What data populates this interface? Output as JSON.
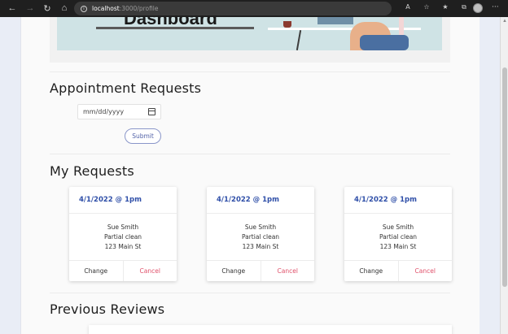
{
  "browser": {
    "url_host": "localhost",
    "url_path": ":3000/profile",
    "info_glyph": "i",
    "nav_icons": [
      "back-arrow-icon",
      "forward-arrow-icon",
      "refresh-icon",
      "home-icon"
    ],
    "toolbar_icons": [
      "read-aloud-icon",
      "favorite-icon",
      "favorites-bar-icon",
      "collections-icon",
      "profile-avatar-icon",
      "more-icon"
    ]
  },
  "hero": {
    "title": "Dashboard"
  },
  "appointment": {
    "title": "Appointment Requests",
    "date_placeholder": "mm/dd/yyyy",
    "submit_label": "Submit"
  },
  "my_requests": {
    "title": "My Requests",
    "cards": [
      {
        "date": "4/1/2022 @ 1pm",
        "name": "Sue Smith",
        "service": "Partial clean",
        "address": "123 Main St",
        "change_label": "Change",
        "cancel_label": "Cancel"
      },
      {
        "date": "4/1/2022 @ 1pm",
        "name": "Sue Smith",
        "service": "Partial clean",
        "address": "123 Main St",
        "change_label": "Change",
        "cancel_label": "Cancel"
      },
      {
        "date": "4/1/2022 @ 1pm",
        "name": "Sue Smith",
        "service": "Partial clean",
        "address": "123 Main St",
        "change_label": "Change",
        "cancel_label": "Cancel"
      }
    ]
  },
  "previous_reviews": {
    "title": "Previous Reviews"
  },
  "colors": {
    "accent": "#2f4fa8",
    "cancel": "#e0506a",
    "chrome_bg": "#1f1f1f",
    "page_bg": "#fafafa"
  }
}
